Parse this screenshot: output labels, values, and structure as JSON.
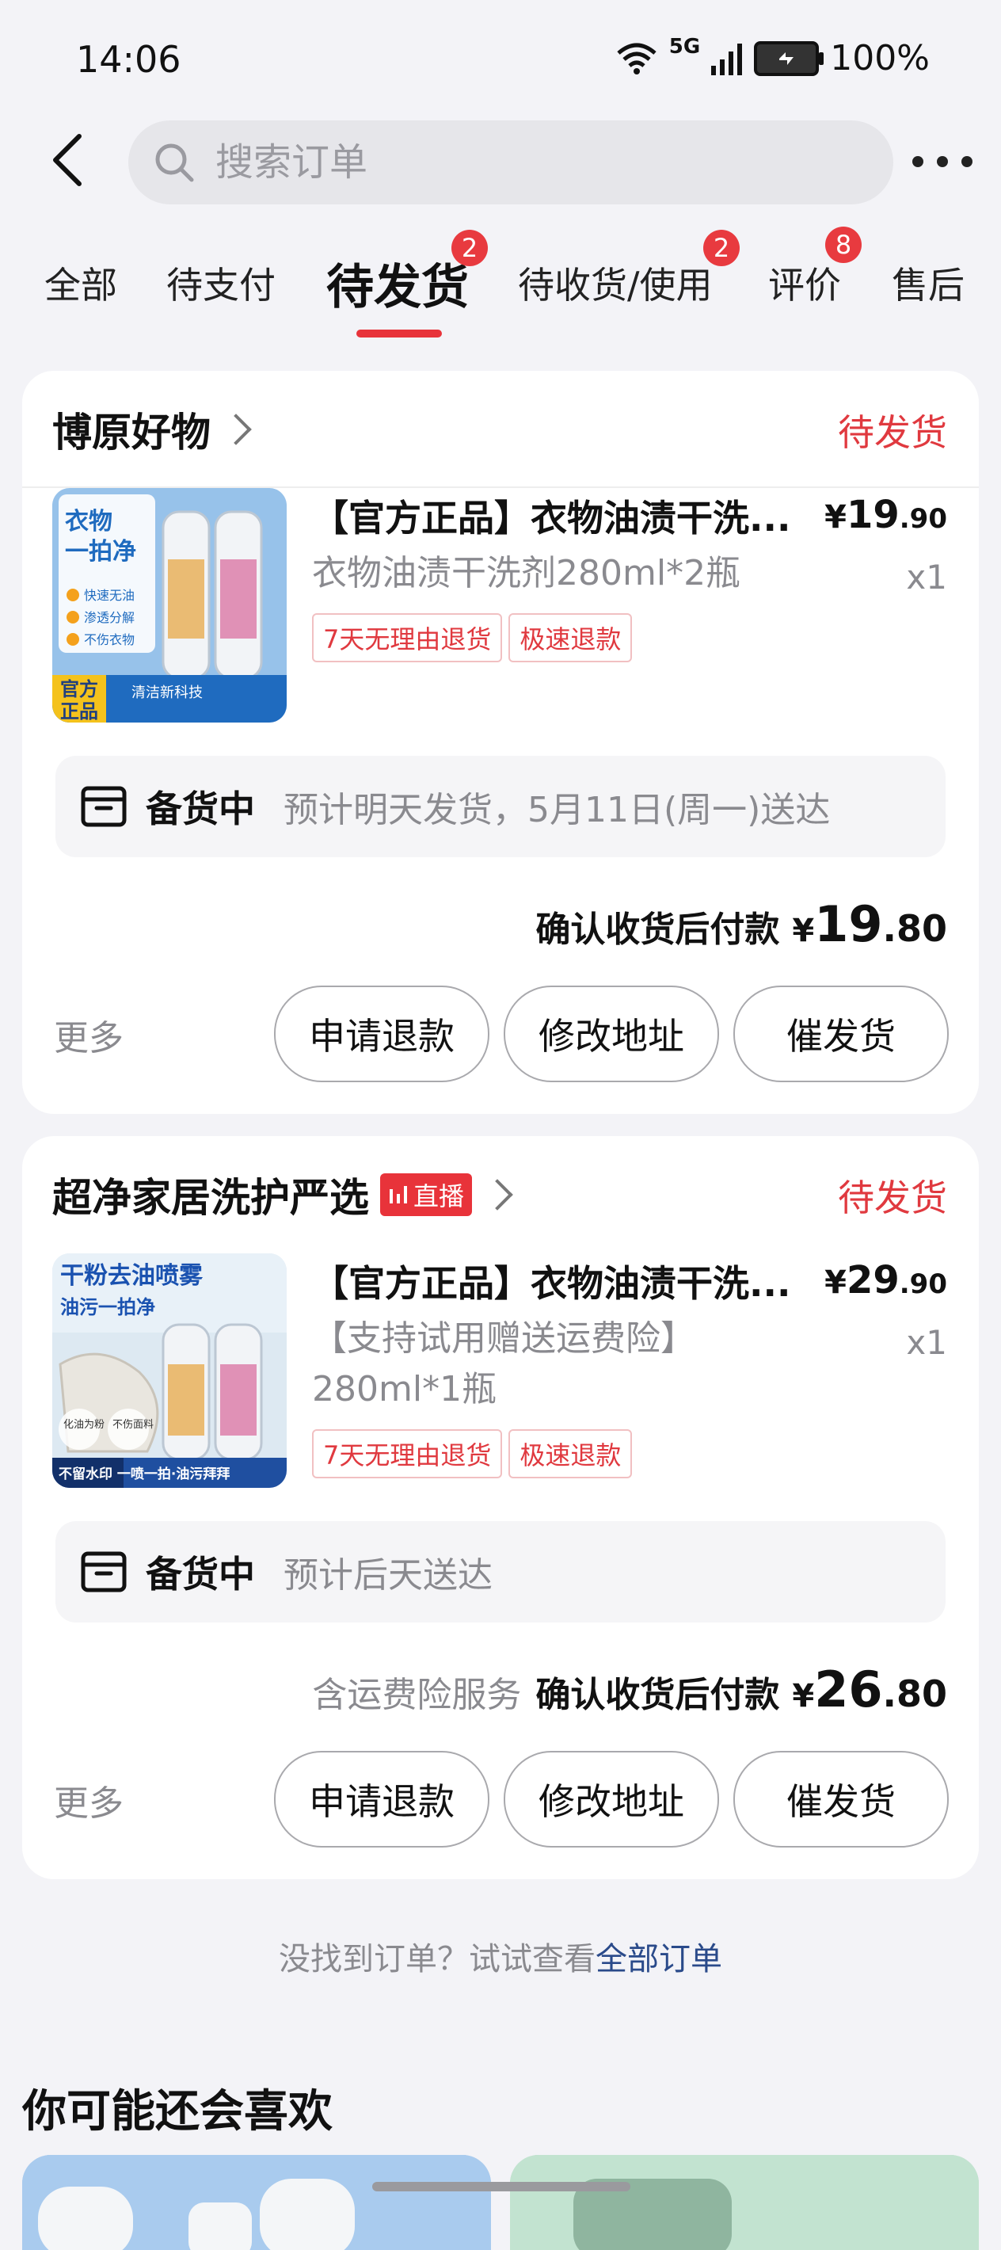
{
  "status_bar": {
    "time": "14:06",
    "network": "5G",
    "battery": "100%"
  },
  "search": {
    "placeholder": "搜索订单"
  },
  "tabs": [
    {
      "label": "全部"
    },
    {
      "label": "待支付"
    },
    {
      "label": "待发货",
      "badge": "2",
      "active": true
    },
    {
      "label": "待收货/使用",
      "badge": "2"
    },
    {
      "label": "评价",
      "badge": "8"
    },
    {
      "label": "售后"
    }
  ],
  "orders": [
    {
      "shop": "博原好物",
      "status": "待发货",
      "product": {
        "title": "【官方正品】衣物油渍干洗...",
        "price_symbol": "¥",
        "price_int": "19",
        "price_dec": ".90",
        "spec": "衣物油渍干洗剂280ml*2瓶",
        "qty": "x1",
        "tags": [
          "7天无理由退货",
          "极速退款"
        ],
        "image_text": {
          "line1": "衣物",
          "line2": "一拍净",
          "b1": "快速无油",
          "b2": "渗透分解",
          "b3": "不伤衣物",
          "corner1": "官方",
          "corner2": "正品",
          "footer": "清洁新科技"
        }
      },
      "shipping": {
        "label": "备货中",
        "eta": "预计明天发货，5月11日(周一)送达"
      },
      "payment": {
        "prefix": "",
        "label": "确认收货后付款",
        "symbol": "¥",
        "int": "19",
        "dec": ".80"
      },
      "more": "更多",
      "buttons": [
        "申请退款",
        "修改地址",
        "催发货"
      ]
    },
    {
      "shop": "超净家居洗护严选",
      "live": "直播",
      "status": "待发货",
      "product": {
        "title": "【官方正品】衣物油渍干洗...",
        "price_symbol": "¥",
        "price_int": "29",
        "price_dec": ".90",
        "spec_line1": "【支持试用赠送运费险】",
        "spec_line2": "280ml*1瓶",
        "qty": "x1",
        "tags": [
          "7天无理由退货",
          "极速退款"
        ],
        "image_text": {
          "line1": "干粉去油喷雾",
          "line2": "油污一拍净",
          "c1": "化油为粉",
          "c2": "不伤面料",
          "footer": "不留水印 一喷一拍·油污拜拜"
        }
      },
      "shipping": {
        "label": "备货中",
        "eta": "预计后天送达"
      },
      "payment": {
        "prefix": "含运费险服务",
        "label": "确认收货后付款",
        "symbol": "¥",
        "int": "26",
        "dec": ".80"
      },
      "more": "更多",
      "buttons": [
        "申请退款",
        "修改地址",
        "催发货"
      ]
    }
  ],
  "footer": {
    "note": "没找到订单？试试查看",
    "link": "全部订单"
  },
  "recommend": {
    "title": "你可能还会喜欢"
  },
  "colors": {
    "accent": "#e8333a",
    "status_red": "#e0393f",
    "link_blue": "#2a4a8a",
    "background": "#f3f3f7"
  }
}
